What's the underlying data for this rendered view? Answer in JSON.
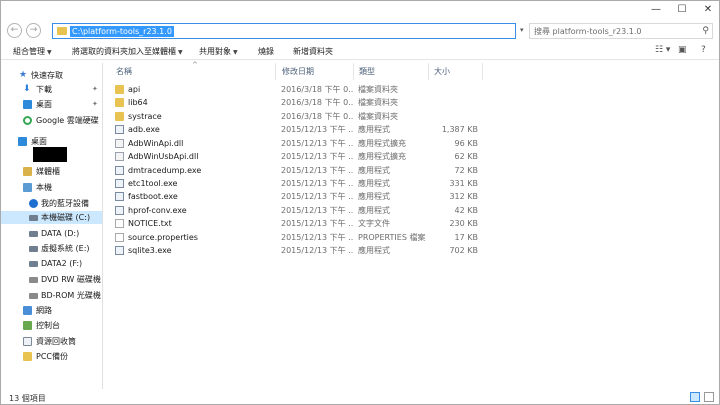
{
  "window": {
    "minimize": "—",
    "maximize": "☐",
    "close": "✕"
  },
  "address": {
    "path": "C:\\platform-tools_r23.1.0"
  },
  "search": {
    "placeholder": "搜尋 platform-tools_r23.1.0"
  },
  "toolbar": {
    "organize": "組合管理",
    "add_to_library": "將選取的資料夾加入至媒體櫃",
    "share_with": "共用對象",
    "burn": "燒錄",
    "new_folder": "新增資料夾"
  },
  "nav": {
    "items": [
      {
        "label": "快速存取",
        "icon": "star-icon"
      },
      {
        "label": "下載",
        "icon": "download-icon"
      },
      {
        "label": "桌面",
        "icon": "desktop-icon"
      },
      {
        "label": "Google 雲端硬碟",
        "icon": "google-drive-icon"
      },
      {
        "label": "桌面",
        "icon": "desktop-icon"
      },
      {
        "label": "媒體櫃",
        "icon": "library-icon"
      },
      {
        "label": "本機",
        "icon": "computer-icon"
      },
      {
        "label": "我的藍牙設備",
        "icon": "bluetooth-icon"
      },
      {
        "label": "本機磁碟 (C:)",
        "icon": "drive-icon"
      },
      {
        "label": "DATA (D:)",
        "icon": "drive-icon"
      },
      {
        "label": "虛擬系統 (E:)",
        "icon": "drive-icon"
      },
      {
        "label": "DATA2 (F:)",
        "icon": "drive-icon"
      },
      {
        "label": "DVD RW 磁碟機 (",
        "icon": "dvd-icon"
      },
      {
        "label": "BD-ROM 光碟機 (",
        "icon": "bd-icon"
      },
      {
        "label": "網路",
        "icon": "network-icon"
      },
      {
        "label": "控制台",
        "icon": "control-panel-icon"
      },
      {
        "label": "資源回收筒",
        "icon": "recycle-bin-icon"
      },
      {
        "label": "PCC備份",
        "icon": "folder-icon"
      }
    ]
  },
  "columns": {
    "name": "名稱",
    "date": "修改日期",
    "type": "類型",
    "size": "大小"
  },
  "files": [
    {
      "name": "api",
      "date": "2016/3/18 下午 0...",
      "type": "檔案資料夾",
      "size": "",
      "icon": "folder"
    },
    {
      "name": "lib64",
      "date": "2016/3/18 下午 0...",
      "type": "檔案資料夾",
      "size": "",
      "icon": "folder"
    },
    {
      "name": "systrace",
      "date": "2016/3/18 下午 0...",
      "type": "檔案資料夾",
      "size": "",
      "icon": "folder"
    },
    {
      "name": "adb.exe",
      "date": "2015/12/13 下午 ...",
      "type": "應用程式",
      "size": "1,387 KB",
      "icon": "exe"
    },
    {
      "name": "AdbWinApi.dll",
      "date": "2015/12/13 下午 ...",
      "type": "應用程式擴充",
      "size": "96 KB",
      "icon": "dll"
    },
    {
      "name": "AdbWinUsbApi.dll",
      "date": "2015/12/13 下午 ...",
      "type": "應用程式擴充",
      "size": "62 KB",
      "icon": "dll"
    },
    {
      "name": "dmtracedump.exe",
      "date": "2015/12/13 下午 ...",
      "type": "應用程式",
      "size": "72 KB",
      "icon": "exe"
    },
    {
      "name": "etc1tool.exe",
      "date": "2015/12/13 下午 ...",
      "type": "應用程式",
      "size": "331 KB",
      "icon": "exe"
    },
    {
      "name": "fastboot.exe",
      "date": "2015/12/13 下午 ...",
      "type": "應用程式",
      "size": "312 KB",
      "icon": "exe"
    },
    {
      "name": "hprof-conv.exe",
      "date": "2015/12/13 下午 ...",
      "type": "應用程式",
      "size": "42 KB",
      "icon": "exe"
    },
    {
      "name": "NOTICE.txt",
      "date": "2015/12/13 下午 ...",
      "type": "文字文件",
      "size": "230 KB",
      "icon": "txt"
    },
    {
      "name": "source.properties",
      "date": "2015/12/13 下午 ...",
      "type": "PROPERTIES 檔案",
      "size": "17 KB",
      "icon": "txt"
    },
    {
      "name": "sqlite3.exe",
      "date": "2015/12/13 下午 ...",
      "type": "應用程式",
      "size": "702 KB",
      "icon": "exe"
    }
  ],
  "status": {
    "count": "13 個項目"
  },
  "colors": {
    "accent": "#3399ff",
    "selection": "#cce8ff",
    "folder": "#e9c351"
  }
}
